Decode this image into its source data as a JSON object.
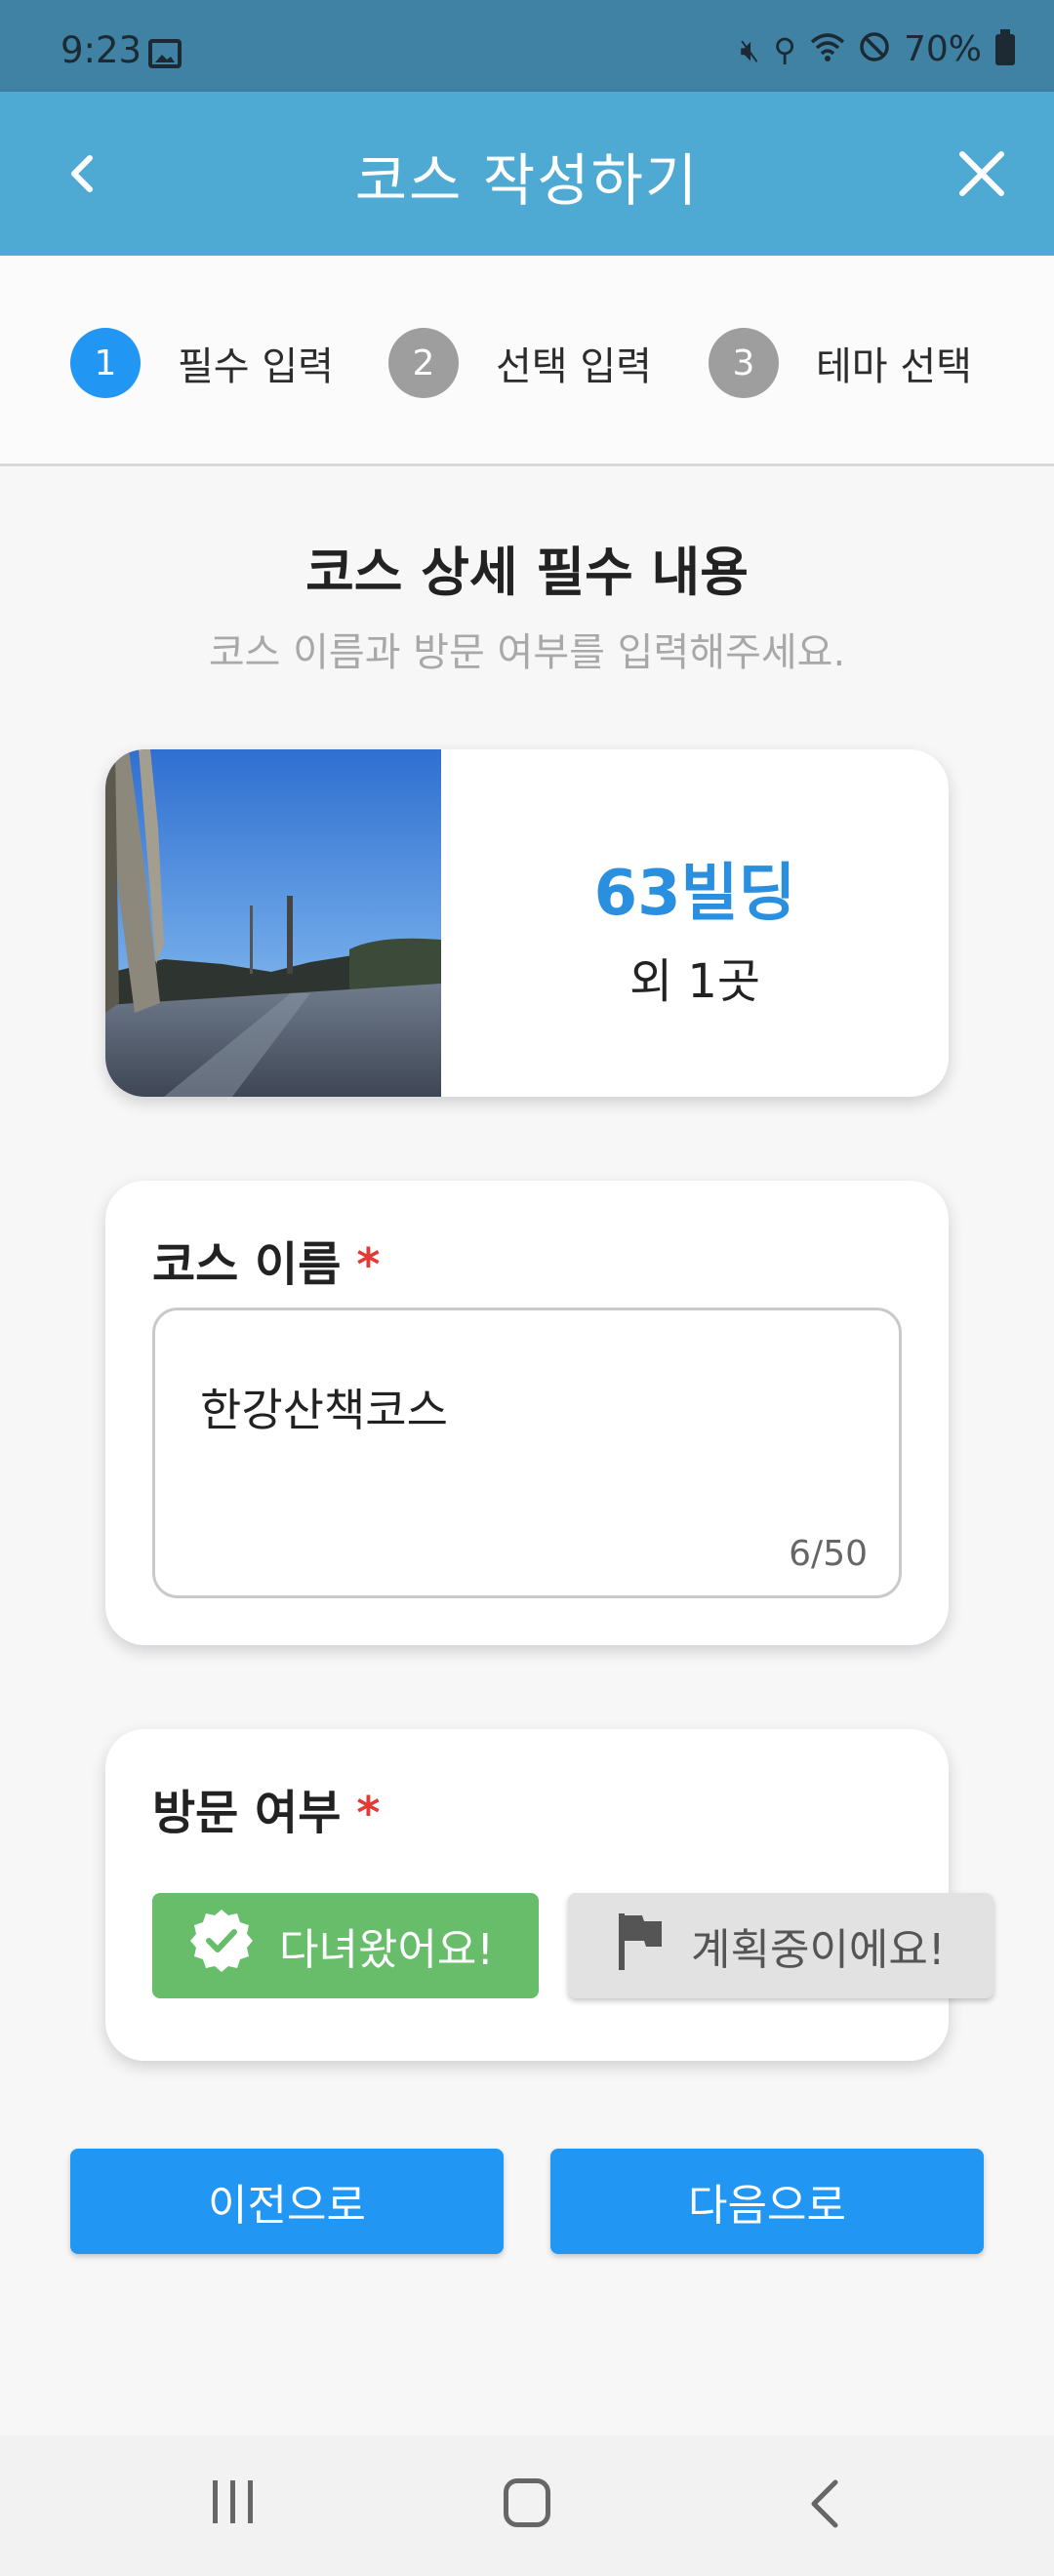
{
  "status_bar": {
    "time": "9:23",
    "battery": "70%",
    "icons": [
      "image-icon",
      "mute-icon",
      "location-icon",
      "wifi-icon",
      "no-disturb-icon",
      "battery-icon"
    ]
  },
  "app_bar": {
    "title": "코스 작성하기",
    "back_icon": "chevron-left-icon",
    "close_icon": "close-icon",
    "color": "#4eaad3"
  },
  "stepper": {
    "steps": [
      {
        "number": "1",
        "label": "필수 입력",
        "active": true
      },
      {
        "number": "2",
        "label": "선택 입력",
        "active": false
      },
      {
        "number": "3",
        "label": "테마 선택",
        "active": false
      }
    ],
    "active_color": "#2196f3",
    "inactive_color": "#9e9e9e"
  },
  "section": {
    "title": "코스 상세 필수 내용",
    "subtitle": "코스 이름과 방문 여부를 입력해주세요."
  },
  "place_card": {
    "name": "63빌딩",
    "extra": "외 1곳"
  },
  "course_name": {
    "label": "코스 이름",
    "required_mark": "*",
    "value": "한강산책코스",
    "counter": "6/50"
  },
  "visit_status": {
    "label": "방문 여부",
    "required_mark": "*",
    "visited_label": "다녀왔어요!",
    "planned_label": "계획중이에요!",
    "selected": "visited",
    "visited_color": "#67bd6a"
  },
  "navigation": {
    "prev_label": "이전으로",
    "next_label": "다음으로",
    "button_color": "#2196f3"
  }
}
